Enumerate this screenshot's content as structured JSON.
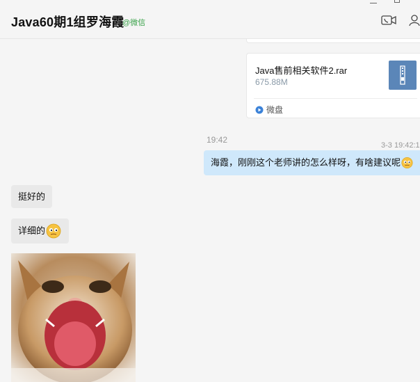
{
  "header": {
    "title": "Java60期1组罗海霞",
    "source_tag": "@微信"
  },
  "file_message": {
    "file_name": "Java售前相关软件2.rar",
    "file_size": "675.88M",
    "app_label": "微盘"
  },
  "timestamps": {
    "center": "19:42",
    "right": "3-3 19:42:1"
  },
  "messages": {
    "outgoing": "海霞，刚刚这个老师讲的怎么样呀，有啥建议呢",
    "incoming_1": "挺好的",
    "incoming_2": "详细的"
  },
  "colors": {
    "accent_green": "#3aa24a",
    "outgoing_bubble": "#cfe8fb",
    "incoming_bubble": "#e9e9e9",
    "file_icon": "#5b86b8"
  },
  "icons": [
    "video-call-icon",
    "person-icon",
    "zip-file-icon",
    "weipan-icon",
    "emoji-icon"
  ]
}
